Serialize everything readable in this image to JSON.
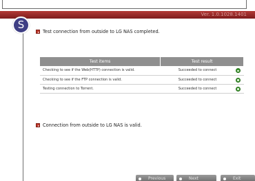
{
  "header": {
    "version": "Ver. 1.0.1028.1401"
  },
  "step": {
    "badge": "S"
  },
  "messages": {
    "top": "Test connection from outside to LG NAS completed.",
    "bottom": "Connection from outside to LG NAS is valid."
  },
  "table": {
    "headers": [
      "Test items",
      "Test result"
    ],
    "rows": [
      {
        "item": "Checking to see if the Web(HTTP) connection is valid.",
        "result": "Succeeded to connect",
        "status_icon": "ok-icon"
      },
      {
        "item": "Checking to see if the FTP connection is valid.",
        "result": "Succeeded to connect",
        "status_icon": "ok-icon"
      },
      {
        "item": "Testing connection to Torrent.",
        "result": "Succeeded to connect",
        "status_icon": "ok-icon"
      }
    ]
  },
  "buttons": {
    "previous": "Previous",
    "next": "Next",
    "exit": "Exit"
  },
  "colors": {
    "header": "#9a2b2b",
    "badge": "#3f3f84",
    "ok": "#3c9a2e",
    "button": "#808080"
  }
}
